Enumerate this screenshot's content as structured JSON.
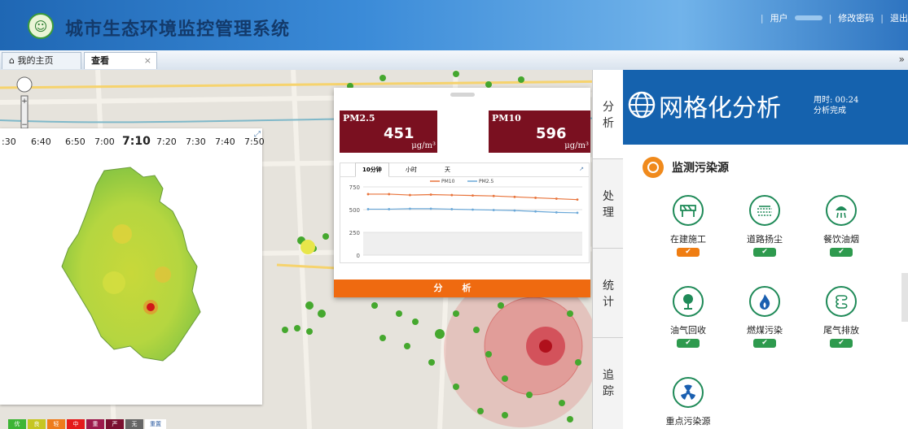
{
  "header": {
    "app_title": "城市生态环境监控管理系统",
    "links": {
      "user_label": "用户",
      "change_password": "修改密码",
      "logout": "退出"
    }
  },
  "tabs": [
    {
      "label": "我的主页",
      "icon": "home-icon"
    },
    {
      "label": "查看",
      "close": "×"
    }
  ],
  "tab_collapse": "»",
  "timeline": {
    "ticks": [
      ":30",
      "6:40",
      "6:50",
      "7:00",
      "7:10",
      "7:20",
      "7:30",
      "7:40",
      "7:50"
    ],
    "current": "7:10"
  },
  "legend": [
    "优",
    "良",
    "轻",
    "中",
    "重",
    "严",
    "无",
    "重置"
  ],
  "popup": {
    "pm25": {
      "label": "PM2.5",
      "value": "451",
      "unit": "μg/m³"
    },
    "pm10": {
      "label": "PM10",
      "value": "596",
      "unit": "μg/m³"
    },
    "chart_tabs": [
      "10分钟",
      "小时",
      "天"
    ],
    "analysis_button": "分析"
  },
  "chart_data": {
    "type": "line",
    "yticks": [
      0,
      250,
      500,
      750
    ],
    "ylim": [
      0,
      750
    ],
    "series": [
      {
        "name": "PM10",
        "color": "#e8733a",
        "values": [
          670,
          670,
          660,
          665,
          660,
          655,
          650,
          640,
          630,
          620,
          610
        ]
      },
      {
        "name": "PM2.5",
        "color": "#6aa8d8",
        "values": [
          505,
          505,
          510,
          510,
          505,
          500,
          495,
          490,
          480,
          470,
          465
        ]
      }
    ]
  },
  "side_nav": [
    "分析",
    "处理",
    "统计",
    "追踪"
  ],
  "grid_panel": {
    "title": "网格化分析",
    "time_label": "用时: 00:24",
    "status": "分析完成",
    "section_title": "监测污染源",
    "sources": [
      {
        "name": "在建施工",
        "icon": "construction-icon",
        "status": "orange"
      },
      {
        "name": "道路扬尘",
        "icon": "road-dust-icon",
        "status": "green"
      },
      {
        "name": "餐饮油烟",
        "icon": "kitchen-fume-icon",
        "status": "green"
      },
      {
        "name": "油气回收",
        "icon": "oil-gas-icon",
        "status": "green"
      },
      {
        "name": "燃煤污染",
        "icon": "coal-flame-icon",
        "status": "green"
      },
      {
        "name": "尾气排放",
        "icon": "exhaust-icon",
        "status": "green"
      },
      {
        "name": "重点污染源",
        "icon": "radiation-icon",
        "status": "none"
      }
    ]
  },
  "colors": {
    "header": "#1f67b4",
    "pm_box": "#7a1020",
    "accent": "#ef6a10",
    "ok": "#2e9a4e"
  }
}
